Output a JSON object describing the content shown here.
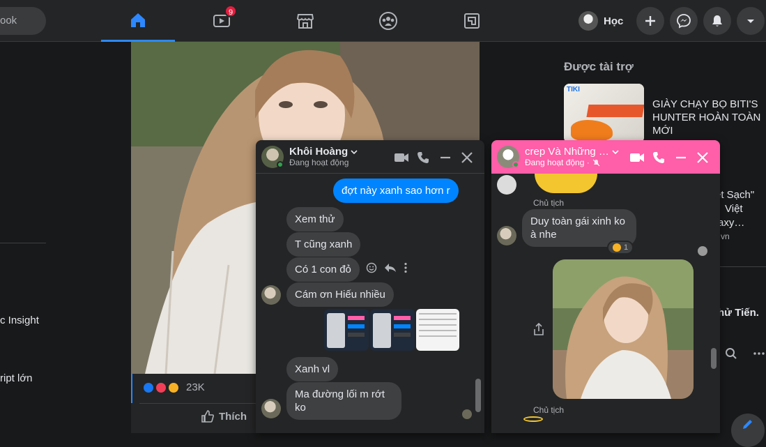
{
  "topbar": {
    "search_placeholder": "ook",
    "tabs": [
      {
        "name": "home",
        "icon": "home-icon",
        "active": true
      },
      {
        "name": "watch",
        "icon": "video-icon",
        "badge": "9"
      },
      {
        "name": "marketplace",
        "icon": "store-icon"
      },
      {
        "name": "groups",
        "icon": "groups-icon"
      },
      {
        "name": "gaming",
        "icon": "gaming-icon"
      }
    ],
    "profile_name": "Học",
    "actions": [
      "plus-icon",
      "messenger-icon",
      "bell-icon",
      "caret-down-icon"
    ]
  },
  "left_sidebar": {
    "item_1": "c Insight",
    "item_2": "ript lớn"
  },
  "post": {
    "reaction_count": "23K",
    "like_label": "Thích"
  },
  "right_rail": {
    "sponsored_title": "Được tài trợ",
    "ad1_text": "GIÀY CHẠY BỌ BITI'S HUNTER HOÀN TOÀN MỚI",
    "ad2_line1": "et Sạch\"",
    "ad2_line2": "Việt",
    "ad2_line3": "axy…",
    "ad2_domain": "vn",
    "birthday_text": "hử Tiến.",
    "birthday_suffix": "."
  },
  "chat1": {
    "name": "Khôi Hoàng",
    "status": "Đang hoạt động",
    "messages": {
      "me1": "đợt này xanh sao hơn r",
      "m1": "Xem thử",
      "m2": "T cũng xanh",
      "m3": "Có 1 con đỏ",
      "m4": "Cám ơn Hiếu nhiều",
      "m5": "Xanh vl",
      "m6_line1": "Ma đường lối m rớt",
      "m6_line2": "ko"
    }
  },
  "chat2": {
    "name": "crep Và Những …",
    "status": "Đang hoạt động ·",
    "sender_label_1": "Chủ tịch",
    "message_1_line1": "Duy toàn gái xinh ko",
    "message_1_line2": "à nhe",
    "reaction_count": "1",
    "sender_label_2": "Chủ tịch"
  },
  "colors": {
    "accent": "#2d88ff",
    "messenger_blue": "#0084ff",
    "group_chat_header": "#ff5ea8",
    "badge_red": "#e41e3f"
  }
}
